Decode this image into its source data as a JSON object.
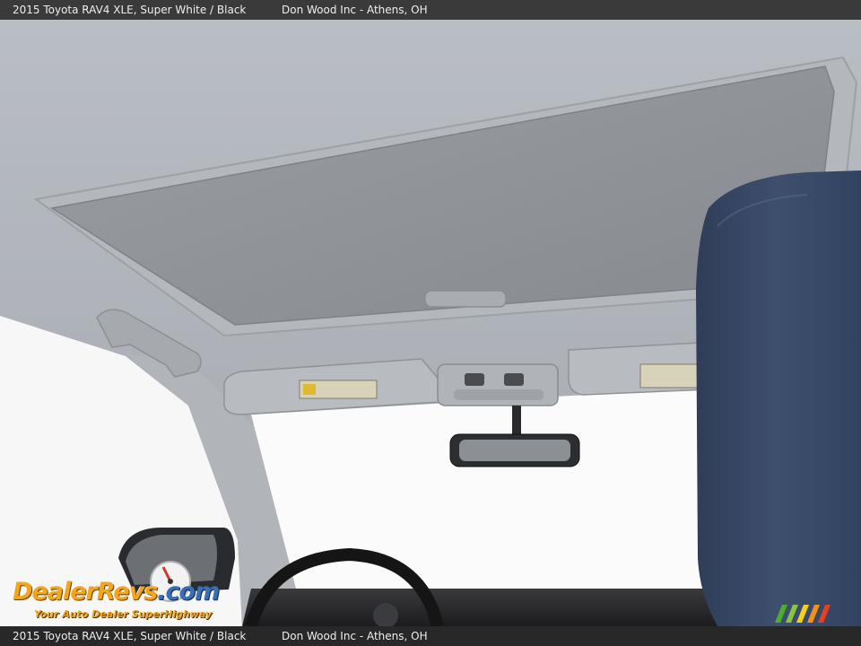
{
  "caption": {
    "vehicle": "2015 Toyota RAV4 XLE,  Super White / Black",
    "dealer": "Don Wood Inc - Athens, OH"
  },
  "watermark": {
    "brand": "DealerRevs",
    "brand_suffix": ".com",
    "tagline": "Your Auto Dealer SuperHighway"
  },
  "colors": {
    "caption_bar": "#3a3a3a",
    "headliner": "#a9adb3",
    "sunroof_shade": "#8f9296",
    "headrest": "#3a4a66",
    "windshield": "#fbfbfb",
    "watermark_orange": "#f3a51b",
    "watermark_blue": "#3b6fb5"
  }
}
